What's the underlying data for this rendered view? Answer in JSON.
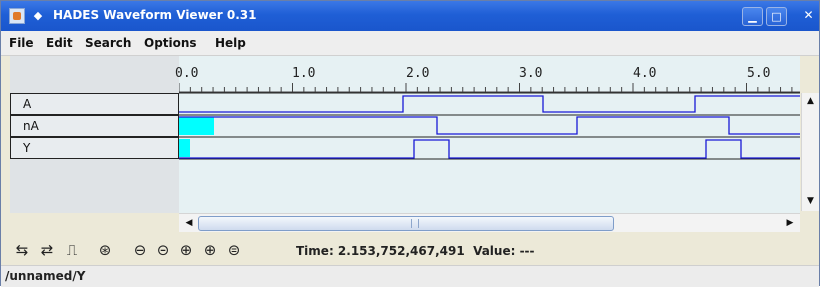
{
  "window": {
    "title": "HADES Waveform Viewer 0.31"
  },
  "menu": [
    "File",
    "Edit",
    "Search",
    "Options",
    "Help"
  ],
  "ruler": {
    "labels": [
      "0.0",
      "1.0",
      "2.0",
      "3.0",
      "4.0",
      "5.0"
    ]
  },
  "signals": [
    {
      "name": "A"
    },
    {
      "name": "nA"
    },
    {
      "name": "Y"
    }
  ],
  "status": {
    "time_label": "Time: 2.153,752,467,491",
    "value_label": "Value: ---"
  },
  "path": "/unnamed/Y",
  "colors": {
    "trace": "#1a1ad6",
    "highlight": "#00ffff",
    "titlebar": "#1f5fd6"
  },
  "icons": [
    "expand-icon",
    "collapse-icon",
    "signal-icon",
    "zoom-fit-icon",
    "zoom-out-icon",
    "zoom-out-alt-icon",
    "zoom-in-icon",
    "zoom-in-alt-icon",
    "zoom-reset-icon"
  ]
}
